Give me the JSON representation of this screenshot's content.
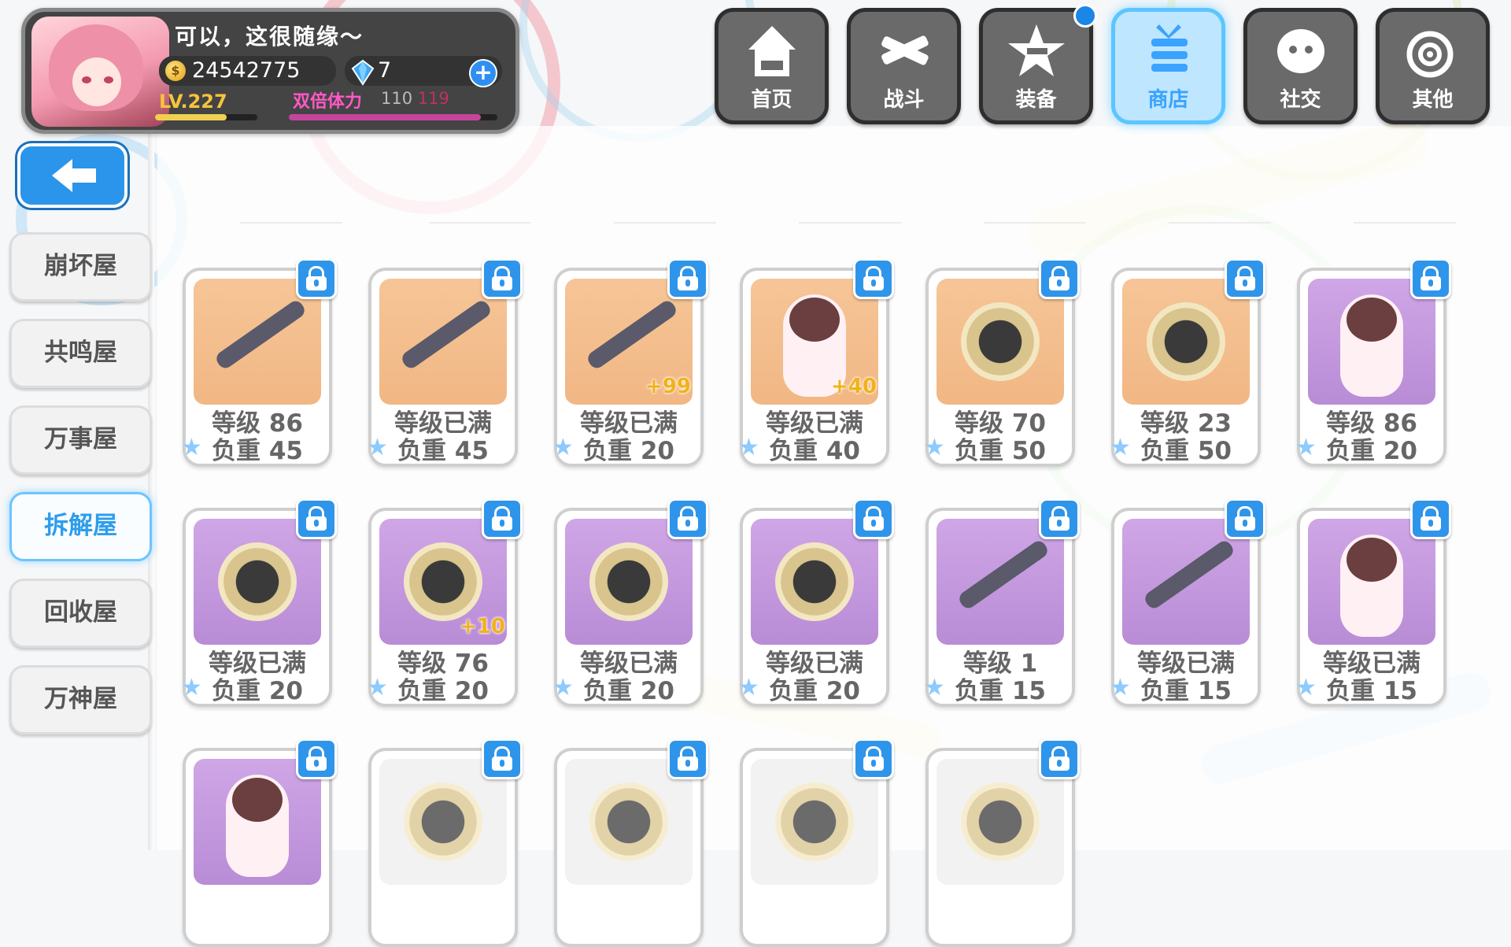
{
  "player": {
    "name": "可以，这很随缘～",
    "coins": "24542775",
    "gems": "7",
    "level": "LV.227",
    "exp_fraction": 0.7,
    "stamina_label": "双倍体力",
    "stamina_current": "110",
    "stamina_max": "119",
    "stamina_fraction": 0.92
  },
  "nav": [
    {
      "label": "首页",
      "icon": "house-icon"
    },
    {
      "label": "战斗",
      "icon": "crossed-guns-icon"
    },
    {
      "label": "装备",
      "icon": "star-gun-icon",
      "badge": true
    },
    {
      "label": "商店",
      "icon": "gift-cart-icon",
      "active": true
    },
    {
      "label": "社交",
      "icon": "ghost-face-icon"
    },
    {
      "label": "其他",
      "icon": "spiral-icon"
    }
  ],
  "sidebar": {
    "back_icon": "back-arrow-icon",
    "items": [
      {
        "label": "崩坏屋"
      },
      {
        "label": "共鸣屋"
      },
      {
        "label": "万事屋"
      },
      {
        "label": "拆解屋",
        "active": true
      },
      {
        "label": "回收屋"
      },
      {
        "label": "万神屋"
      }
    ]
  },
  "items": [
    {
      "art": "weapon",
      "bg": "orange",
      "level": "等级 86",
      "weight": "负重 45"
    },
    {
      "art": "weapon",
      "bg": "orange",
      "level": "等级已满",
      "weight": "负重 45"
    },
    {
      "art": "weapon",
      "bg": "orange",
      "level": "等级已满",
      "weight": "负重 20",
      "plus": "+99"
    },
    {
      "art": "chibi",
      "bg": "orange",
      "level": "等级已满",
      "weight": "负重 40",
      "plus": "+40"
    },
    {
      "art": "medal",
      "bg": "orange",
      "level": "等级 70",
      "weight": "负重 50"
    },
    {
      "art": "medal",
      "bg": "orange",
      "level": "等级 23",
      "weight": "负重 50"
    },
    {
      "art": "chibi",
      "bg": "purple",
      "level": "等级 86",
      "weight": "负重 20"
    },
    {
      "art": "medal",
      "bg": "purple",
      "level": "等级已满",
      "weight": "负重 20"
    },
    {
      "art": "medal",
      "bg": "purple",
      "level": "等级 76",
      "weight": "负重 20",
      "plus": "+10"
    },
    {
      "art": "medal",
      "bg": "purple",
      "level": "等级已满",
      "weight": "负重 20"
    },
    {
      "art": "medal",
      "bg": "purple",
      "level": "等级已满",
      "weight": "负重 20"
    },
    {
      "art": "weapon",
      "bg": "purple",
      "level": "等级 1",
      "weight": "负重 15"
    },
    {
      "art": "weapon",
      "bg": "purple",
      "level": "等级已满",
      "weight": "负重 15"
    },
    {
      "art": "chibi",
      "bg": "purple",
      "level": "等级已满",
      "weight": "负重 15"
    },
    {
      "art": "chibi",
      "bg": "purple",
      "level": "",
      "weight": ""
    },
    {
      "art": "medal",
      "bg": "gray",
      "level": "",
      "weight": ""
    },
    {
      "art": "medal",
      "bg": "gray",
      "level": "",
      "weight": ""
    },
    {
      "art": "medal",
      "bg": "gray",
      "level": "",
      "weight": ""
    },
    {
      "art": "medal",
      "bg": "gray",
      "level": "",
      "weight": ""
    }
  ],
  "colors": {
    "accent": "#2e95ea",
    "plus_tag": "#f2b21a",
    "stamina_label": "#ff58c8"
  }
}
